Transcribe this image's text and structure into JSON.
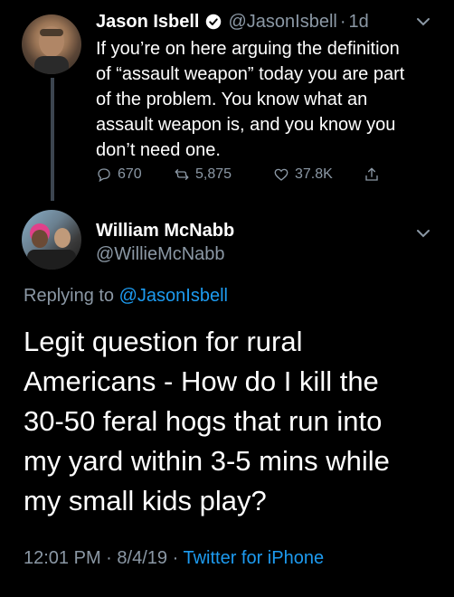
{
  "tweet1": {
    "name": "Jason Isbell",
    "handle": "@JasonIsbell",
    "separator": "·",
    "time": "1d",
    "verified_icon": "verified-badge-icon",
    "text_lines": [
      "If you’re on here arguing the definition",
      "of “assault weapon” today you are part",
      "of the problem. You know what an",
      "assault weapon is, and you know you",
      "don’t need one."
    ],
    "actions": {
      "reply_count": "670",
      "retweet_count": "5,875",
      "like_count": "37.8K"
    },
    "icons": [
      "reply-icon",
      "retweet-icon",
      "like-icon",
      "share-icon",
      "chevron-down-icon"
    ]
  },
  "tweet2": {
    "name": "William McNabb",
    "handle": "@WillieMcNabb",
    "replying_prefix": "Replying to",
    "replying_handle": "@JasonIsbell",
    "text_lines": [
      "Legit question for rural",
      "Americans - How do I kill the",
      "30-50 feral hogs that run into",
      "my yard within 3-5 mins while",
      "my small kids play?"
    ],
    "time": "12:01 PM",
    "date": "8/4/19",
    "meta_separator": "·",
    "source": "Twitter for iPhone"
  },
  "colors": {
    "background": "#000000",
    "text": "#ffffff",
    "muted": "#8b98a5",
    "accent": "#1d9bf0",
    "thread_line": "#3c4550"
  }
}
